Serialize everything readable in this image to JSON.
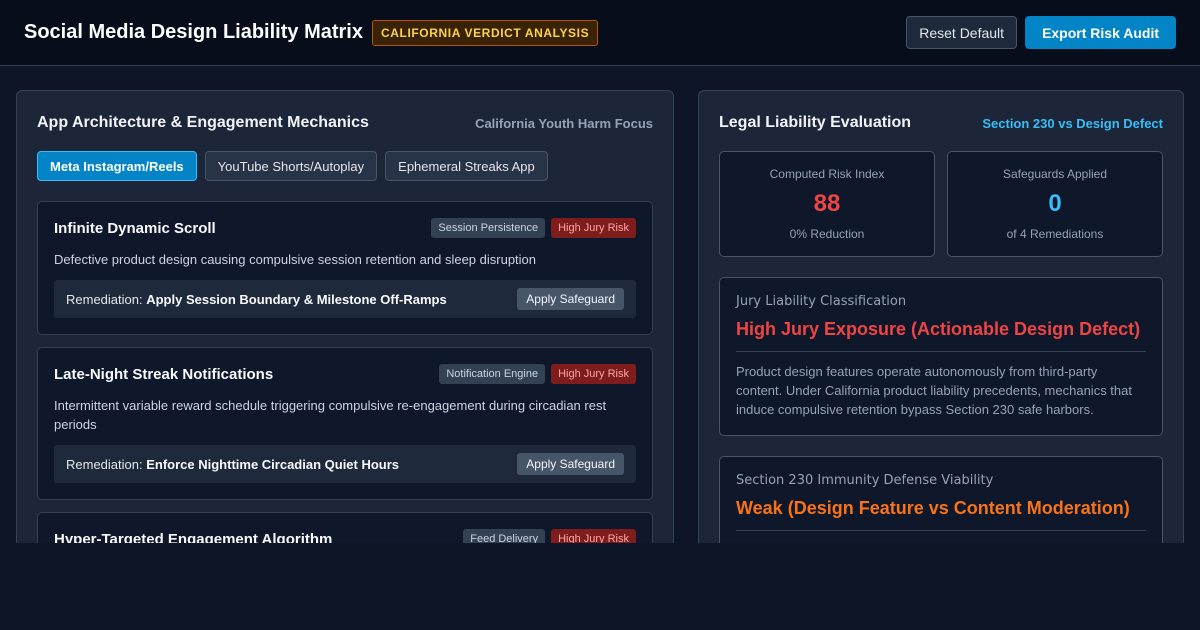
{
  "header": {
    "title": "Social Media Design Liability Matrix",
    "badge": "CALIFORNIA VERDICT ANALYSIS",
    "reset_label": "Reset Default",
    "export_label": "Export Risk Audit"
  },
  "left_panel": {
    "title": "App Architecture & Engagement Mechanics",
    "subtitle": "California Youth Harm Focus",
    "tabs": [
      {
        "label": "Meta Instagram/Reels",
        "active": true
      },
      {
        "label": "YouTube Shorts/Autoplay",
        "active": false
      },
      {
        "label": "Ephemeral Streaks App",
        "active": false
      }
    ],
    "mechanics": [
      {
        "title": "Infinite Dynamic Scroll",
        "component": "Session Persistence",
        "risk": "High Jury Risk",
        "description": "Defective product design causing compulsive session retention and sleep disruption",
        "remediation_prefix": "Remediation: ",
        "remediation": "Apply Session Boundary & Milestone Off-Ramps",
        "action": "Apply Safeguard"
      },
      {
        "title": "Late-Night Streak Notifications",
        "component": "Notification Engine",
        "risk": "High Jury Risk",
        "description": "Intermittent variable reward schedule triggering compulsive re-engagement during circadian rest periods",
        "remediation_prefix": "Remediation: ",
        "remediation": "Enforce Nighttime Circadian Quiet Hours",
        "action": "Apply Safeguard"
      },
      {
        "title": "Hyper-Targeted Engagement Algorithm",
        "component": "Feed Delivery",
        "risk": "High Jury Risk"
      }
    ]
  },
  "right_panel": {
    "title": "Legal Liability Evaluation",
    "subtitle": "Section 230 vs Design Defect",
    "metrics": [
      {
        "label": "Computed Risk Index",
        "value": "88",
        "foot": "0% Reduction",
        "color": "#ef4444"
      },
      {
        "label": "Safeguards Applied",
        "value": "0",
        "foot": "of 4 Remediations",
        "color": "#38bdf8"
      }
    ],
    "classifications": [
      {
        "label": "Jury Liability Classification",
        "value": "High Jury Exposure (Actionable Design Defect)",
        "description": "Product design features operate autonomously from third-party content. Under California product liability precedents, mechanics that induce compulsive retention bypass Section 230 safe harbors."
      },
      {
        "label": "Section 230 Immunity Defense Viability",
        "value": "Weak (Design Feature vs Content Moderation)"
      }
    ]
  }
}
